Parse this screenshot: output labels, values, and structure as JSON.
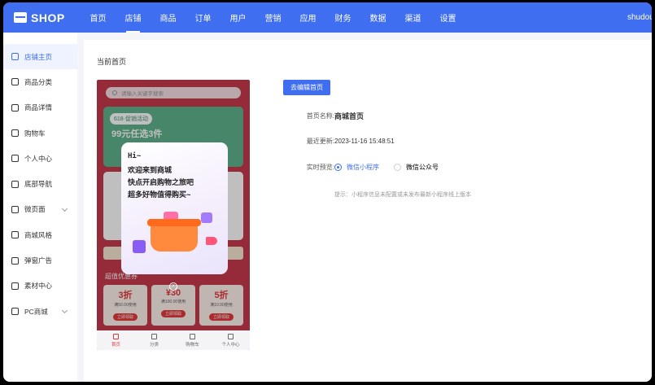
{
  "app": {
    "logo_text": "SHOP",
    "user": "shudou"
  },
  "nav": [
    "首页",
    "店铺",
    "商品",
    "订单",
    "用户",
    "营销",
    "应用",
    "财务",
    "数据",
    "渠道",
    "设置"
  ],
  "sidebar": [
    {
      "label": "店铺主页",
      "icon": "home-icon"
    },
    {
      "label": "商品分类",
      "icon": "category-icon"
    },
    {
      "label": "商品详情",
      "icon": "detail-icon"
    },
    {
      "label": "购物车",
      "icon": "cart-icon"
    },
    {
      "label": "个人中心",
      "icon": "user-icon"
    },
    {
      "label": "底部导航",
      "icon": "send-icon"
    },
    {
      "label": "微页面",
      "icon": "page-icon"
    },
    {
      "label": "商城风格",
      "icon": "palette-icon"
    },
    {
      "label": "弹窗广告",
      "icon": "popup-icon"
    },
    {
      "label": "素材中心",
      "icon": "image-icon"
    },
    {
      "label": "PC商城",
      "icon": "monitor-icon"
    }
  ],
  "main": {
    "title": "当前首页",
    "edit_button": "去编辑首页",
    "fields": {
      "name_label": "首页名称:",
      "name_value": "商城首页",
      "updated_label": "最近更新:",
      "updated_value": "2023-11-16 15:48:51",
      "preview_label": "实时预览:",
      "preview_options": [
        "微信小程序",
        "微信公众号"
      ]
    },
    "hint": "提示：小程序信息未配置或未发布最新小程序线上版本"
  },
  "phone": {
    "search_placeholder": "请输入关键字搜索",
    "banner_tag": "618·促销活动",
    "banner_text": "99元任选3件",
    "coupon_title": "超值优惠券",
    "coupons": [
      {
        "value": "3折",
        "sub": "满50.00使用",
        "btn": "立即领取"
      },
      {
        "value": "¥30",
        "sub": "满100.00使用",
        "btn": "立即领取"
      },
      {
        "value": "5折",
        "sub": "满10.00使用",
        "btn": "立即领取"
      }
    ],
    "popup_lines": [
      "Hi~",
      "欢迎来到商城",
      "快点开启购物之旅吧",
      "超多好物值得购买~"
    ],
    "tabs": [
      "首页",
      "分类",
      "购物车",
      "个人中心"
    ]
  },
  "colors": {
    "accent": "#3f6ff0",
    "phone_bg": "#c73a4d"
  }
}
